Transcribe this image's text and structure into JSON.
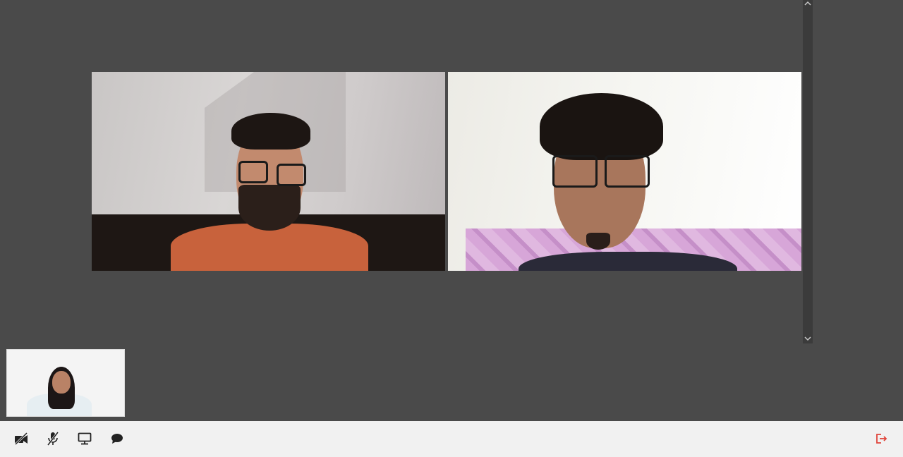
{
  "app": {
    "background_color": "#4a4a4a",
    "toolbar_color": "#f1f1f1",
    "hangup_color": "#e0443b"
  },
  "participants": [
    {
      "id": "participant-1",
      "shirt_color": "#c8623c",
      "wall_color": "#d0cccc"
    },
    {
      "id": "participant-2",
      "shirt_color": "#2a2a38",
      "wall_color": "#f3f3ee"
    }
  ],
  "self_view": {
    "shirt_color": "#e6eef2"
  },
  "toolbar": {
    "buttons": [
      {
        "name": "toggle-camera-button",
        "icon": "video-off-icon"
      },
      {
        "name": "toggle-mic-button",
        "icon": "mic-off-icon"
      },
      {
        "name": "share-screen-button",
        "icon": "monitor-icon"
      },
      {
        "name": "chat-button",
        "icon": "chat-bubble-icon"
      }
    ],
    "hangup": {
      "name": "leave-call-button",
      "icon": "exit-icon"
    }
  },
  "scrollbar": {
    "up_icon": "chevron-up-icon",
    "down_icon": "chevron-down-icon"
  }
}
